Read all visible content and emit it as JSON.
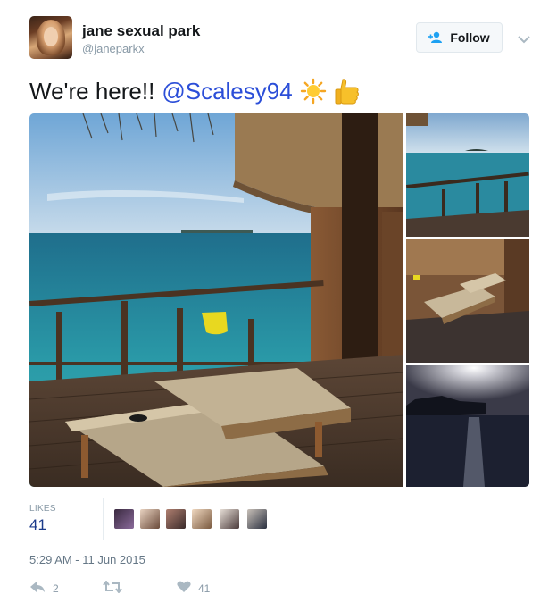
{
  "user": {
    "name": "jane sexual park",
    "handle": "@janeparkx"
  },
  "follow_button": {
    "label": "Follow"
  },
  "tweet": {
    "text": "We're here!!",
    "mention": "@Scalesy94",
    "emojis": [
      "sun-emoji",
      "thumbs-up-emoji"
    ]
  },
  "stats": {
    "likes_label": "LIKES",
    "likes_count": "41"
  },
  "timestamp": "5:29 AM - 11 Jun 2015",
  "actions": {
    "reply_count": "2",
    "retweet_count": "",
    "like_count": "41"
  },
  "colors": {
    "mention": "#2b4ed8",
    "likes_count": "#1b3a8a",
    "muted": "#8899a6"
  }
}
